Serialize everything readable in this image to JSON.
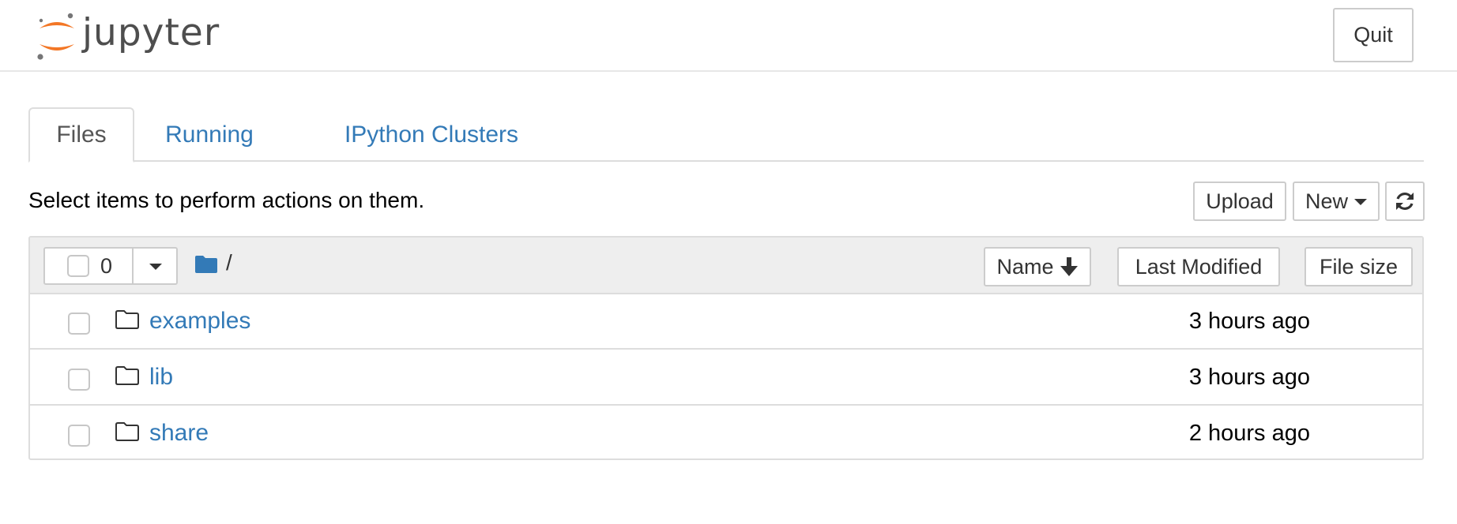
{
  "header": {
    "logo_text": "jupyter",
    "quit_label": "Quit"
  },
  "tabs": [
    {
      "label": "Files",
      "active": true
    },
    {
      "label": "Running",
      "active": false
    },
    {
      "label": "IPython Clusters",
      "active": false
    }
  ],
  "toolbar": {
    "hint": "Select items to perform actions on them.",
    "upload_label": "Upload",
    "new_label": "New",
    "refresh_icon": "refresh-icon"
  },
  "list_header": {
    "selected_count": "0",
    "breadcrumb_path": "/",
    "sort_name_label": "Name",
    "sort_modified_label": "Last Modified",
    "sort_size_label": "File size"
  },
  "files": [
    {
      "name": "examples",
      "type": "folder",
      "modified": "3 hours ago"
    },
    {
      "name": "lib",
      "type": "folder",
      "modified": "3 hours ago"
    },
    {
      "name": "share",
      "type": "folder",
      "modified": "2 hours ago"
    }
  ],
  "colors": {
    "link": "#337ab7",
    "logo_orange": "#f37726",
    "logo_grey": "#767677",
    "header_bg": "#eeeeee",
    "border": "#dddddd"
  }
}
